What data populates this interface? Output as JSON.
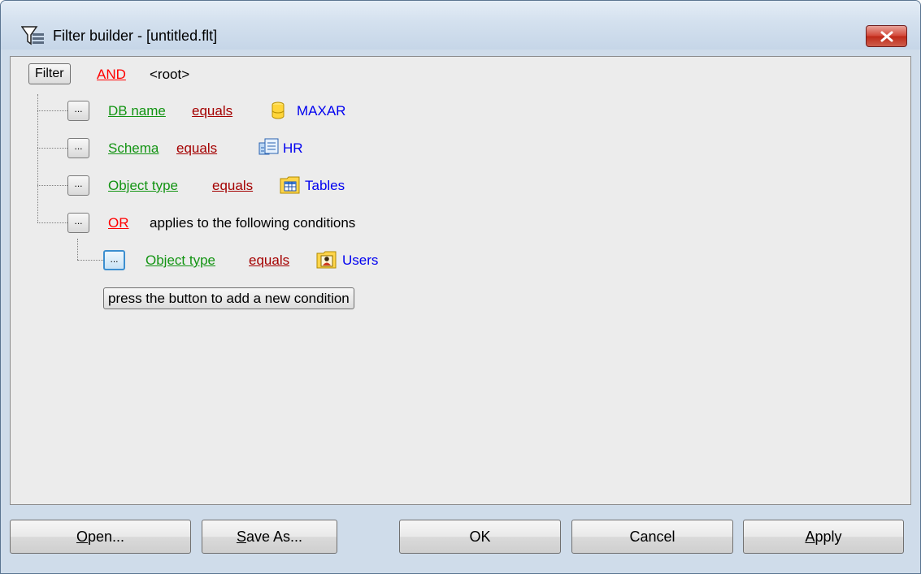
{
  "window": {
    "title": "Filter builder - [untitled.flt]"
  },
  "root": {
    "filter_button": "Filter",
    "operator": "AND",
    "label": "<root>"
  },
  "conditions": [
    {
      "button": "...",
      "field": "DB name",
      "operator": "equals",
      "icon": "database-icon",
      "value": "MAXAR"
    },
    {
      "button": "...",
      "field": "Schema",
      "operator": "equals",
      "icon": "schema-icon",
      "value": "HR"
    },
    {
      "button": "...",
      "field": "Object type",
      "operator": "equals",
      "icon": "table-icon",
      "value": "Tables"
    }
  ],
  "group": {
    "button": "...",
    "operator": "OR",
    "text": "applies to the following conditions",
    "conditions": [
      {
        "button": "...",
        "field": "Object type",
        "operator": "equals",
        "icon": "users-icon",
        "value": "Users"
      }
    ],
    "add_hint": "press the button to add a new condition"
  },
  "buttons": {
    "open_first": "O",
    "open_rest": "pen...",
    "save_first": "S",
    "save_rest": "ave As...",
    "ok": "OK",
    "cancel": "Cancel",
    "apply_first": "A",
    "apply_rest": "pply"
  }
}
